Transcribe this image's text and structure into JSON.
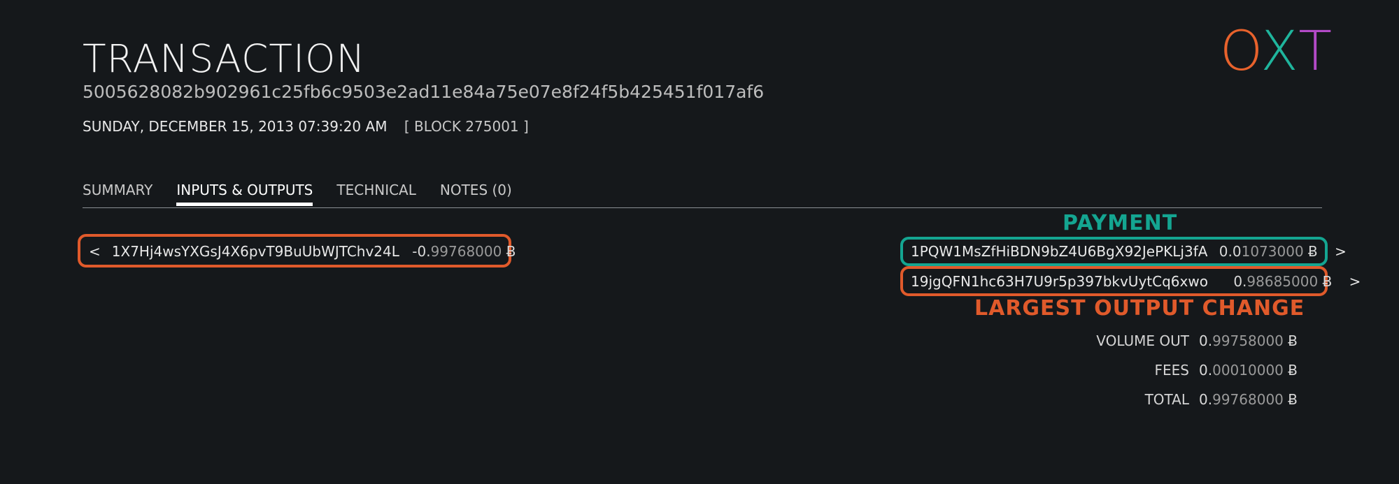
{
  "header": {
    "title": "TRANSACTION",
    "hash": "5005628082b902961c25fb6c9503e2ad11e84a75e07e8f24f5b425451f017af6",
    "datetime": "SUNDAY, DECEMBER 15, 2013 07:39:20 AM",
    "block": "[ BLOCK 275001 ]"
  },
  "logo": {
    "letters": [
      "O",
      "X",
      "T"
    ],
    "colors": [
      "#e8622c",
      "#1fb59d",
      "#b34ac7"
    ]
  },
  "tabs": [
    {
      "label": "SUMMARY"
    },
    {
      "label": "INPUTS & OUTPUTS",
      "active": true
    },
    {
      "label": "TECHNICAL"
    },
    {
      "label": "NOTES (0)"
    }
  ],
  "inputs": [
    {
      "nav": "<",
      "address": "1X7Hj4wsYXGsJ4X6pvT9BuUbWJTChv24L",
      "amount_lead": "-0.",
      "amount_rest": "99768000",
      "unit": "Ƀ"
    }
  ],
  "outputs": [
    {
      "address": "1PQW1MsZfHiBDN9bZ4U6BgX92JePKLj3fA",
      "amount_lead": "0.0",
      "amount_rest": "1073000",
      "unit": "Ƀ",
      "nav": ">"
    },
    {
      "address": "19jgQFN1hc63H7U9r5p397bkvUytCq6xwo",
      "amount_lead": "0.",
      "amount_rest": "98685000",
      "unit": "Ƀ",
      "nav": ">"
    }
  ],
  "annotations": {
    "payment": "PAYMENT",
    "change": "LARGEST OUTPUT CHANGE",
    "payment_color": "#14a591",
    "change_color": "#e05a2b"
  },
  "summary": {
    "volume_out_label": "VOLUME OUT",
    "volume_out_lead": "0.",
    "volume_out_rest": "99758000",
    "fees_label": "FEES",
    "fees_lead": "0.",
    "fees_rest": "00010000",
    "total_label": "TOTAL",
    "total_lead": "0.",
    "total_rest": "99768000",
    "unit": "Ƀ"
  }
}
